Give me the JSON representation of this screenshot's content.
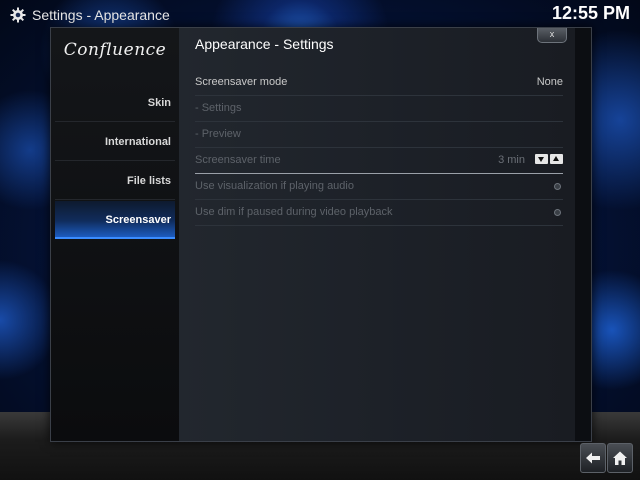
{
  "header": {
    "title": "Settings - Appearance",
    "clock": "12:55 PM"
  },
  "sidebar": {
    "logo": "Confluence",
    "items": [
      {
        "label": "Skin",
        "active": false
      },
      {
        "label": "International",
        "active": false
      },
      {
        "label": "File lists",
        "active": false
      },
      {
        "label": "Screensaver",
        "active": true
      }
    ]
  },
  "content": {
    "title": "Appearance - Settings",
    "close_label": "x",
    "rows": [
      {
        "label": "Screensaver mode",
        "value": "None",
        "enabled": true,
        "control": "value"
      },
      {
        "label": "- Settings",
        "value": "",
        "enabled": false,
        "control": "none"
      },
      {
        "label": "- Preview",
        "value": "",
        "enabled": false,
        "control": "none"
      },
      {
        "label": "Screensaver time",
        "value": "3 min",
        "enabled": false,
        "control": "spinner"
      },
      {
        "label": "Use visualization if playing audio",
        "value": "",
        "enabled": false,
        "control": "radio"
      },
      {
        "label": "Use dim if paused during video playback",
        "value": "",
        "enabled": false,
        "control": "radio"
      }
    ]
  },
  "icons": {
    "header": "gear-icon",
    "back": "back-arrow-icon",
    "home": "home-icon"
  },
  "colors": {
    "accent": "#1c5cc0",
    "text_enabled": "#c9c9c9",
    "text_disabled": "#5d6269"
  }
}
